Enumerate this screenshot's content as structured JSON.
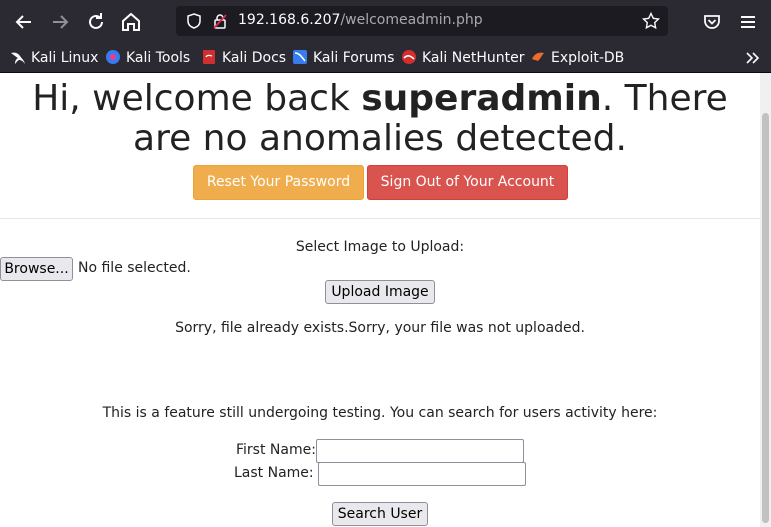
{
  "browser": {
    "url_host": "192.168.6.207",
    "url_path": "/welcomeadmin.php"
  },
  "bookmarks": [
    {
      "label": "Kali Linux"
    },
    {
      "label": "Kali Tools"
    },
    {
      "label": "Kali Docs"
    },
    {
      "label": "Kali Forums"
    },
    {
      "label": "Kali NetHunter"
    },
    {
      "label": "Exploit-DB"
    }
  ],
  "page": {
    "greeting_prefix": "Hi, welcome back ",
    "username": "superadmin",
    "greeting_suffix": ". There are no anomalies detected.",
    "reset_password_label": "Reset Your Password",
    "sign_out_label": "Sign Out of Your Account",
    "upload": {
      "heading": "Select Image to Upload:",
      "browse_label": "Browse...",
      "file_status": "No file selected.",
      "upload_label": "Upload Image",
      "result_message": "Sorry, file already exists.Sorry, your file was not uploaded."
    },
    "search": {
      "intro": "This is a feature still undergoing testing. You can search for users activity here:",
      "first_name_label": "First Name:",
      "first_name_value": "",
      "last_name_label": "Last Name:",
      "last_name_value": "",
      "search_label": "Search User"
    }
  }
}
